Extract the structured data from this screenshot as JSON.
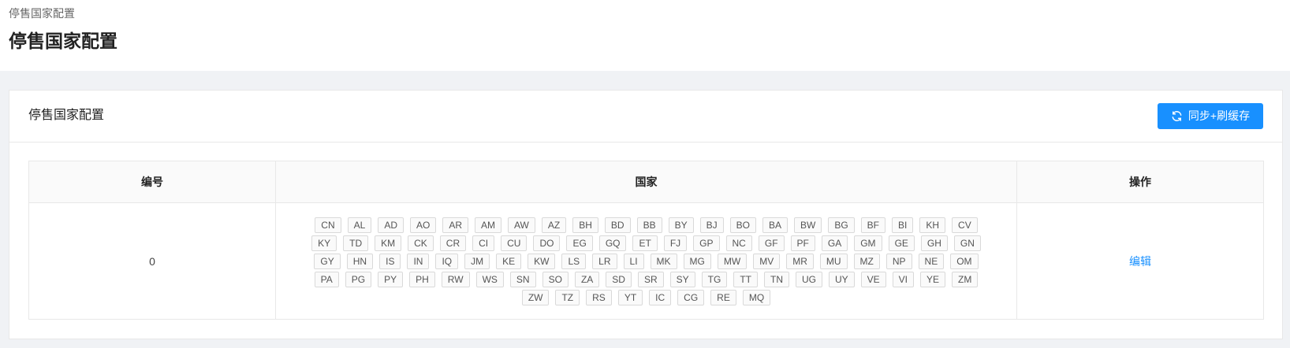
{
  "breadcrumb": "停售国家配置",
  "page_title": "停售国家配置",
  "card": {
    "title": "停售国家配置",
    "sync_button_label": "同步+刷缓存"
  },
  "table": {
    "headers": {
      "id": "编号",
      "country": "国家",
      "action": "操作"
    },
    "rows": [
      {
        "id": "0",
        "edit_label": "编辑",
        "countries": [
          "CN",
          "AL",
          "AD",
          "AO",
          "AR",
          "AM",
          "AW",
          "AZ",
          "BH",
          "BD",
          "BB",
          "BY",
          "BJ",
          "BO",
          "BA",
          "BW",
          "BG",
          "BF",
          "BI",
          "KH",
          "CV",
          "KY",
          "TD",
          "KM",
          "CK",
          "CR",
          "CI",
          "CU",
          "DO",
          "EG",
          "GQ",
          "ET",
          "FJ",
          "GP",
          "NC",
          "GF",
          "PF",
          "GA",
          "GM",
          "GE",
          "GH",
          "GN",
          "GY",
          "HN",
          "IS",
          "IN",
          "IQ",
          "JM",
          "KE",
          "KW",
          "LS",
          "LR",
          "LI",
          "MK",
          "MG",
          "MW",
          "MV",
          "MR",
          "MU",
          "MZ",
          "NP",
          "NE",
          "OM",
          "PA",
          "PG",
          "PY",
          "PH",
          "RW",
          "WS",
          "SN",
          "SO",
          "ZA",
          "SD",
          "SR",
          "SY",
          "TG",
          "TT",
          "TN",
          "UG",
          "UY",
          "VE",
          "VI",
          "YE",
          "ZM",
          "ZW",
          "TZ",
          "RS",
          "YT",
          "IC",
          "CG",
          "RE",
          "MQ"
        ]
      }
    ]
  },
  "colors": {
    "primary": "#1890ff",
    "background": "#f0f2f5"
  },
  "icons": {
    "sync_button": "sync-icon"
  }
}
